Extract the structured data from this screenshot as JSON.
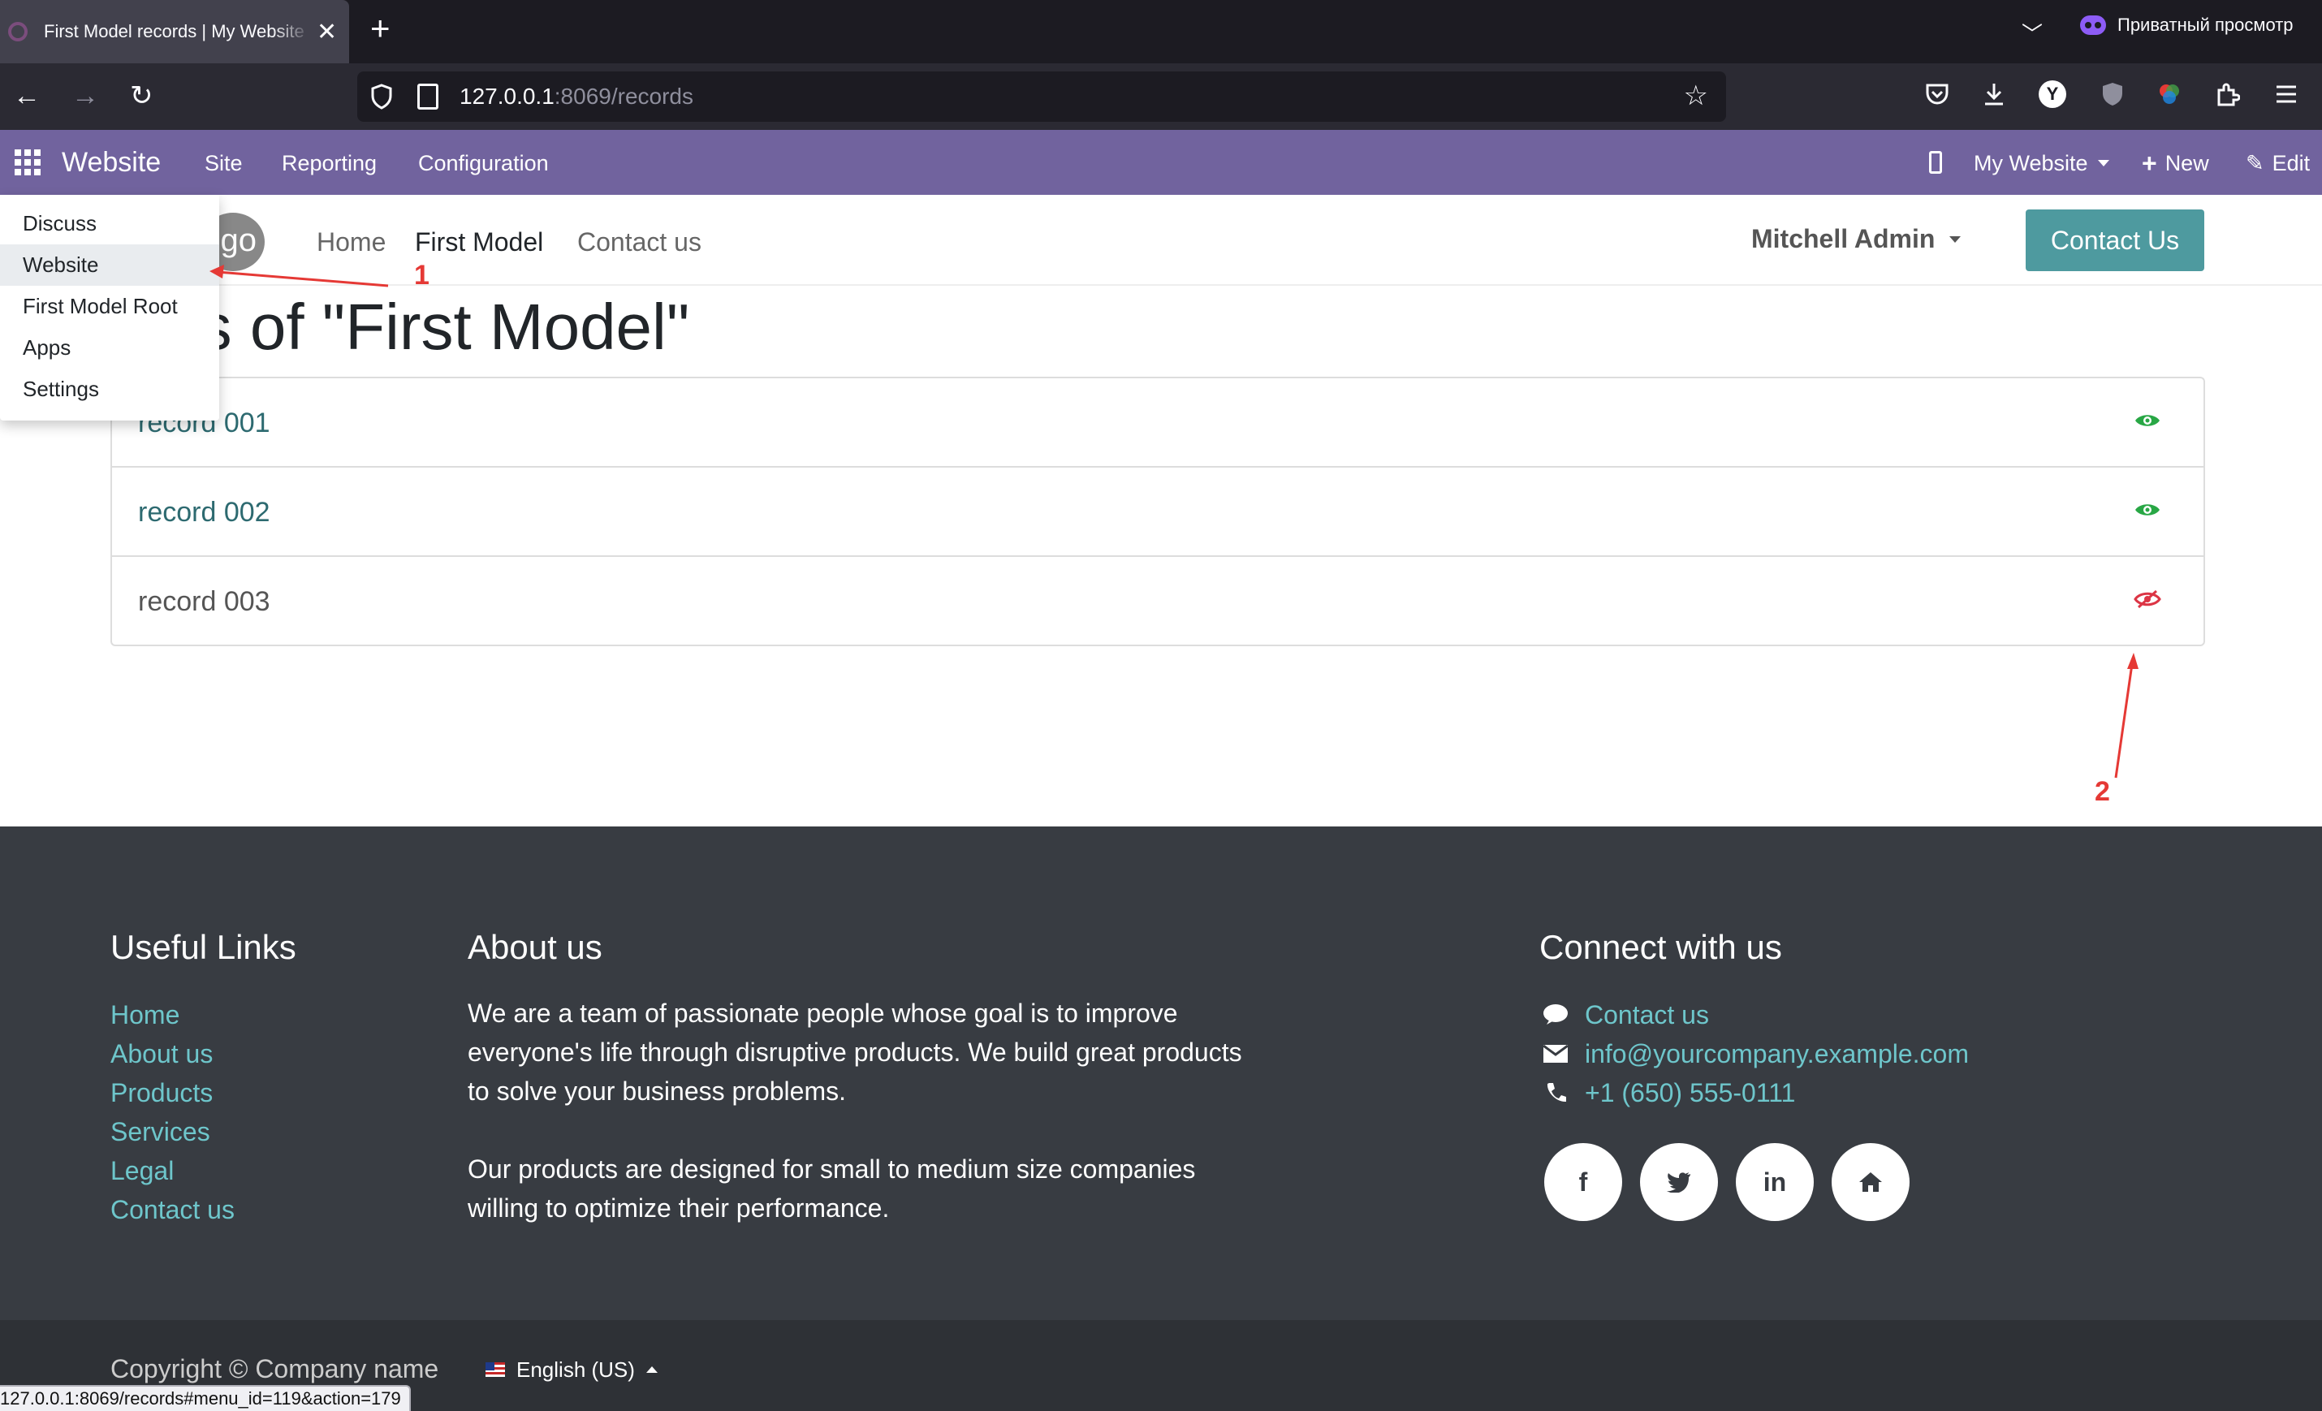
{
  "browser": {
    "tab_title": "First Model records | My Website",
    "private_label": "Приватный просмотр",
    "url_host": "127.0.0.1",
    "url_rest": ":8069/records",
    "status_url": "127.0.0.1:8069/records#menu_id=119&action=179"
  },
  "odoo_bar": {
    "brand": "Website",
    "menus": [
      "Site",
      "Reporting",
      "Configuration"
    ],
    "website_selector": "My Website",
    "new_label": "New",
    "edit_label": "Edit"
  },
  "apps_dropdown": {
    "items": [
      "Discuss",
      "Website",
      "First Model Root",
      "Apps",
      "Settings"
    ],
    "active_index": 1
  },
  "site_header": {
    "logo_text": "go",
    "nav": [
      "Home",
      "First Model",
      "Contact us"
    ],
    "active_nav": "First Model",
    "user": "Mitchell Admin",
    "cta": "Contact Us"
  },
  "page_title": "ords of \"First Model\"",
  "records": [
    {
      "name": "record 001",
      "published": true
    },
    {
      "name": "record 002",
      "published": true
    },
    {
      "name": "record 003",
      "published": false
    }
  ],
  "annotations": {
    "one": "1",
    "two": "2"
  },
  "colors": {
    "odoo_bar": "#71639e",
    "published": "#28a745",
    "unpublished": "#dc3545",
    "link": "#6ec6cb",
    "cta": "#4e9a9f"
  },
  "footer": {
    "useful_links_title": "Useful Links",
    "useful_links": [
      "Home",
      "About us",
      "Products",
      "Services",
      "Legal",
      "Contact us"
    ],
    "about_title": "About us",
    "about_lines_1": [
      "We are a team of passionate people whose goal is to improve",
      "everyone's life through disruptive products. We build great products",
      "to solve your business problems."
    ],
    "about_lines_2": [
      "Our products are designed for small to medium size companies",
      "willing to optimize their performance."
    ],
    "connect_title": "Connect with us",
    "contact_label": "Contact us",
    "email": "info@yourcompany.example.com",
    "phone": "+1 (650) 555-0111",
    "social": {
      "facebook": "f",
      "linkedin": "in"
    }
  },
  "copyright": "Copyright © Company name",
  "language": "English (US)"
}
